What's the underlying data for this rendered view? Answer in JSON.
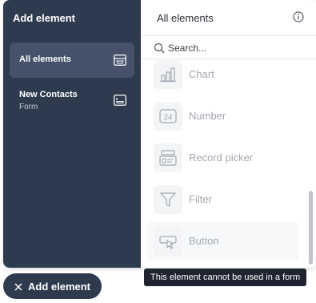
{
  "sidebar": {
    "title": "Add element",
    "items": [
      {
        "label": "All elements",
        "sub": ""
      },
      {
        "label": "New Contacts",
        "sub": "Form"
      }
    ]
  },
  "main": {
    "title": "All elements",
    "search_placeholder": "Search...",
    "elements": [
      {
        "label": "Chart",
        "icon": "bar-chart-icon"
      },
      {
        "label": "Number",
        "icon": "number-icon"
      },
      {
        "label": "Record picker",
        "icon": "record-picker-icon"
      },
      {
        "label": "Filter",
        "icon": "filter-icon"
      },
      {
        "label": "Button",
        "icon": "cursor-button-icon"
      }
    ]
  },
  "tooltip": "This element cannot be used in a form",
  "add_button": "Add element",
  "colors": {
    "sidebar_bg": "#2e3a4e",
    "sidebar_active": "#45526a",
    "tooltip_bg": "#1f2430",
    "muted_text": "#a3a8b0"
  }
}
